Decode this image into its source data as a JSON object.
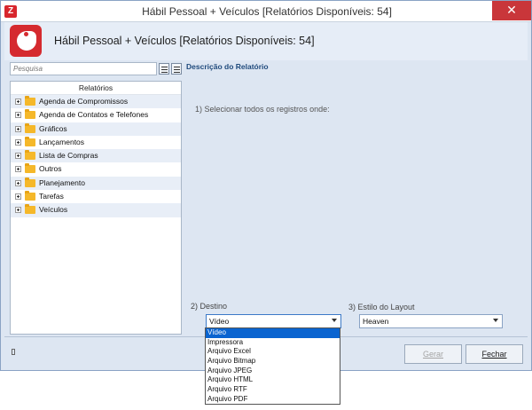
{
  "window": {
    "title": "Hábil Pessoal + Veículos [Relatórios Disponíveis: 54]",
    "close_glyph": "✕"
  },
  "header": {
    "title": "Hábil Pessoal + Veículos [Relatórios Disponíveis: 54]"
  },
  "search": {
    "placeholder": "Pesquisa"
  },
  "tree": {
    "header": "Relatórios",
    "items": [
      {
        "label": "Agenda de Compromissos"
      },
      {
        "label": "Agenda de Contatos e Telefones"
      },
      {
        "label": "Gráficos"
      },
      {
        "label": "Lançamentos"
      },
      {
        "label": "Lista de Compras"
      },
      {
        "label": "Outros"
      },
      {
        "label": "Planejamento"
      },
      {
        "label": "Tarefas"
      },
      {
        "label": "Veículos"
      }
    ]
  },
  "description": {
    "title": "Descrição do Relatório",
    "step1": "1) Selecionar todos os registros onde:"
  },
  "destino": {
    "label": "2) Destino",
    "selected": "Vídeo",
    "options": [
      "Vídeo",
      "Impressora",
      "Arquivo Excel",
      "Arquivo Bitmap",
      "Arquivo JPEG",
      "Arquivo HTML",
      "Arquivo RTF",
      "Arquivo PDF"
    ]
  },
  "estilo": {
    "label": "3) Estilo do Layout",
    "selected": "Heaven"
  },
  "buttons": {
    "gerar": "Gerar",
    "fechar": "Fechar"
  },
  "colors": {
    "accent": "#d52a2f",
    "selection": "#0a64d0",
    "panel": "#dde6f2"
  }
}
